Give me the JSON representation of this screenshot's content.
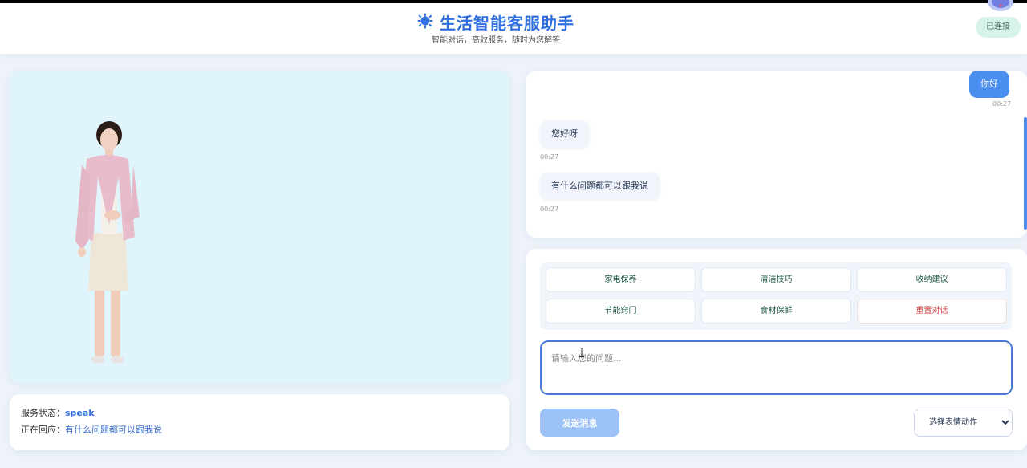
{
  "header": {
    "title": "生活智能客服助手",
    "subtitle": "智能对话，高效服务，随时为您解答",
    "connection_status": "已连接",
    "accent_color": "#2f6fe0",
    "title_icon": "gear-sun-icon",
    "avatar_icon": "robot-icon"
  },
  "video": {
    "background_color": "#e0f5fb",
    "avatar_description_icon": "virtual-agent-figure"
  },
  "status": {
    "state_label": "服务状态：",
    "state_value": "speak",
    "responding_label": "正在回应：",
    "responding_value": "有什么问题都可以跟我说"
  },
  "chat": {
    "messages": [
      {
        "role": "user",
        "text": "你好",
        "time": "00:27"
      },
      {
        "role": "bot",
        "text": "您好呀",
        "time": "00:27"
      },
      {
        "role": "bot",
        "text": "有什么问题都可以跟我说",
        "time": "00:27"
      }
    ]
  },
  "quick_actions": [
    "家电保养",
    "清洁技巧",
    "收纳建议",
    "节能窍门",
    "食材保鲜",
    "重置对话"
  ],
  "input": {
    "placeholder": "请输入您的问题...",
    "value": ""
  },
  "send_button": {
    "label": "发送消息"
  },
  "emote_select": {
    "selected": "选择表情动作"
  }
}
